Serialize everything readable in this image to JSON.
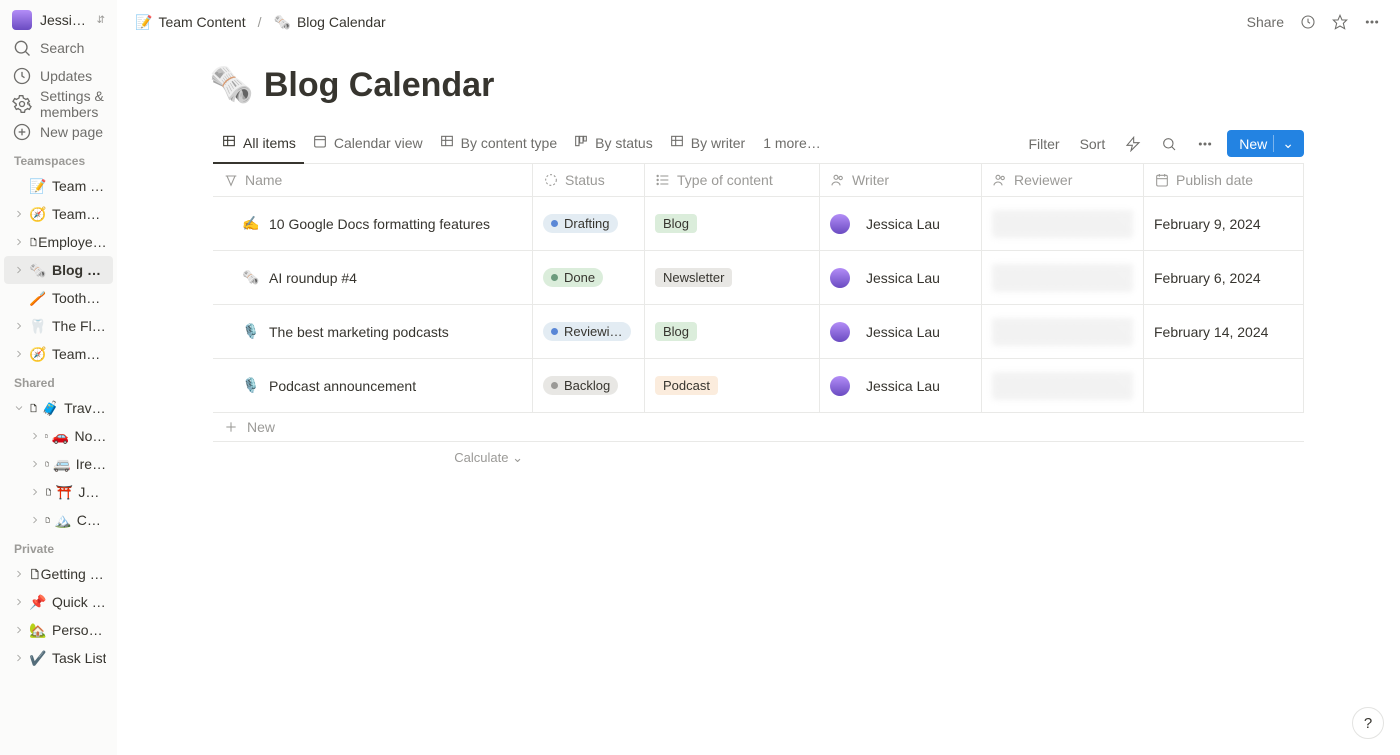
{
  "workspace": {
    "name": "Jessica Lau's N…"
  },
  "nav": {
    "search": "Search",
    "updates": "Updates",
    "settings": "Settings & members",
    "new_page": "New page"
  },
  "sections": {
    "teamspaces": "Teamspaces",
    "shared": "Shared",
    "private": "Private"
  },
  "teamspaces": [
    {
      "emoji": "📝",
      "label": "Team Content",
      "header": true
    },
    {
      "emoji": "🧭",
      "label": "Teamspace Home"
    },
    {
      "emoji": "page",
      "label": "Employee Directory"
    },
    {
      "emoji": "🗞️",
      "label": "Blog Calendar",
      "active": true
    },
    {
      "emoji": "🪥",
      "label": "Toothbrush HQ",
      "header": true
    },
    {
      "emoji": "🦷",
      "label": "The Floss Hub"
    },
    {
      "emoji": "🧭",
      "label": "Teamspace Home"
    }
  ],
  "shared": {
    "parent": {
      "emoji": "🧳",
      "label": "Travel plans"
    },
    "children": [
      {
        "emoji": "🚗",
        "label": "Northern Ireland ro…"
      },
      {
        "emoji": "🚐",
        "label": "Ireland road trip"
      },
      {
        "emoji": "⛩️",
        "label": "Japan trip"
      },
      {
        "emoji": "🏔️",
        "label": "Colorado trip"
      }
    ]
  },
  "private": [
    {
      "emoji": "page",
      "label": "Getting Started"
    },
    {
      "emoji": "📌",
      "label": "Quick Note"
    },
    {
      "emoji": "🏡",
      "label": "Personal Home"
    },
    {
      "emoji": "✔️",
      "label": "Task List"
    }
  ],
  "breadcrumbs": [
    {
      "emoji": "📝",
      "label": "Team Content"
    },
    {
      "emoji": "🗞️",
      "label": "Blog Calendar"
    }
  ],
  "topbar": {
    "share": "Share"
  },
  "page": {
    "emoji": "🗞️",
    "title": "Blog Calendar"
  },
  "views": {
    "tabs": [
      {
        "icon": "table",
        "label": "All items",
        "active": true
      },
      {
        "icon": "calendar",
        "label": "Calendar view"
      },
      {
        "icon": "table",
        "label": "By content type"
      },
      {
        "icon": "board",
        "label": "By status"
      },
      {
        "icon": "table",
        "label": "By writer"
      }
    ],
    "more": "1 more…",
    "filter": "Filter",
    "sort": "Sort",
    "new": "New"
  },
  "columns": {
    "name": "Name",
    "status": "Status",
    "type": "Type of content",
    "writer": "Writer",
    "reviewer": "Reviewer",
    "publish": "Publish date"
  },
  "rows": [
    {
      "emoji": "✍️",
      "name": "10 Google Docs formatting features",
      "status": {
        "label": "Drafting",
        "bg": "#e3ecf3",
        "dot": "#5a87d6"
      },
      "type": {
        "label": "Blog",
        "bg": "#dbeddb"
      },
      "writer": "Jessica Lau",
      "publish": "February 9, 2024"
    },
    {
      "emoji": "🗞️",
      "name": "AI roundup #4",
      "status": {
        "label": "Done",
        "bg": "#dbeddb",
        "dot": "#6c9b7d"
      },
      "type": {
        "label": "Newsletter",
        "bg": "#e8e7e4"
      },
      "writer": "Jessica Lau",
      "publish": "February 6, 2024"
    },
    {
      "emoji": "🎙️",
      "name": "The best marketing podcasts",
      "status": {
        "label": "Reviewi…",
        "bg": "#e3ecf3",
        "dot": "#5a87d6"
      },
      "type": {
        "label": "Blog",
        "bg": "#dbeddb"
      },
      "writer": "Jessica Lau",
      "publish": "February 14, 2024"
    },
    {
      "emoji": "🎙️",
      "name": "Podcast announcement",
      "status": {
        "label": "Backlog",
        "bg": "#e8e7e4",
        "dot": "#9b9a97"
      },
      "type": {
        "label": "Podcast",
        "bg": "#fbecdd"
      },
      "writer": "Jessica Lau",
      "publish": ""
    }
  ],
  "footer": {
    "new": "New",
    "calculate": "Calculate"
  },
  "help": "?"
}
